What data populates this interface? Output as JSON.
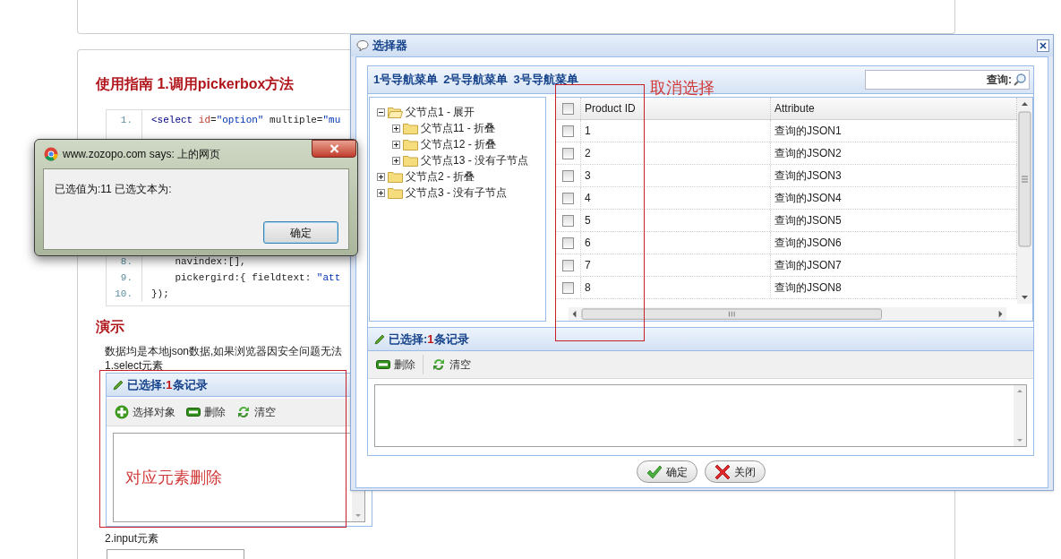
{
  "background_page": {
    "guide_heading": "使用指南 1.调用pickerbox方法",
    "code_lines": [
      {
        "number": "1.",
        "tokens": [
          {
            "kind": "tag",
            "text": "<select"
          },
          {
            "kind": "attr",
            "text": " id"
          },
          {
            "kind": "plain",
            "text": "="
          },
          {
            "kind": "string",
            "text": "\"option\""
          },
          {
            "kind": "plain",
            "text": " multiple="
          },
          {
            "kind": "string",
            "text": "\"mu"
          }
        ]
      },
      {
        "number": "8.",
        "tokens": [
          {
            "kind": "plain",
            "text": "    navindex:[],"
          }
        ]
      },
      {
        "number": "9.",
        "tokens": [
          {
            "kind": "plain",
            "text": "    pickergird:{ fieldtext: "
          },
          {
            "kind": "string",
            "text": "\"att"
          }
        ]
      },
      {
        "number": "10.",
        "tokens": [
          {
            "kind": "plain",
            "text": "});"
          }
        ]
      }
    ],
    "demo_heading": "演示",
    "demo_note": "数据均是本地json数据,如果浏览器因安全问题无法",
    "select_label": "1.select元素",
    "select_panel": {
      "title_prefix": "已选择:",
      "count": "1",
      "title_suffix": "条记录",
      "toolbar": [
        {
          "kind": "add",
          "label": "选择对象"
        },
        {
          "kind": "remove",
          "label": "删除"
        },
        {
          "kind": "refresh",
          "label": "清空"
        }
      ],
      "annotation": "对应元素删除"
    },
    "input_label": "2.input元素"
  },
  "picker_dialog": {
    "title": "选择器",
    "nav_menus": [
      "1号导航菜单",
      "2号导航菜单",
      "3号导航菜单"
    ],
    "search": {
      "label": "查询:"
    },
    "tree": [
      {
        "label": "父节点1 - 展开",
        "expanded": true,
        "children": [
          {
            "label": "父节点11 - 折叠",
            "expanded": false
          },
          {
            "label": "父节点12 - 折叠",
            "expanded": false
          },
          {
            "label": "父节点13 - 没有子节点",
            "expanded": false
          }
        ]
      },
      {
        "label": "父节点2 - 折叠",
        "expanded": false
      },
      {
        "label": "父节点3 - 没有子节点",
        "expanded": false
      }
    ],
    "grid": {
      "header_checked": false,
      "columns": [
        "Product ID",
        "Attribute"
      ],
      "rows": [
        {
          "checked": false,
          "cells": [
            "1",
            "查询的JSON1"
          ]
        },
        {
          "checked": false,
          "cells": [
            "2",
            "查询的JSON2"
          ]
        },
        {
          "checked": false,
          "cells": [
            "3",
            "查询的JSON3"
          ]
        },
        {
          "checked": false,
          "cells": [
            "4",
            "查询的JSON4"
          ]
        },
        {
          "checked": false,
          "cells": [
            "5",
            "查询的JSON5"
          ]
        },
        {
          "checked": false,
          "cells": [
            "6",
            "查询的JSON6"
          ]
        },
        {
          "checked": false,
          "cells": [
            "7",
            "查询的JSON7"
          ]
        },
        {
          "checked": false,
          "cells": [
            "8",
            "查询的JSON8"
          ]
        }
      ]
    },
    "annotation": "取消选择",
    "selected_panel": {
      "title_prefix": "已选择:",
      "count": "1",
      "title_suffix": "条记录",
      "toolbar": [
        {
          "kind": "remove",
          "label": "删除"
        },
        {
          "kind": "refresh",
          "label": "清空"
        }
      ]
    },
    "buttons": [
      {
        "kind": "ok",
        "label": "确定"
      },
      {
        "kind": "close",
        "label": "关闭"
      }
    ]
  },
  "alert_dialog": {
    "title": "www.zozopo.com says: 上的网页",
    "message": "已选值为:11 已选文本为:",
    "button": "确定"
  }
}
